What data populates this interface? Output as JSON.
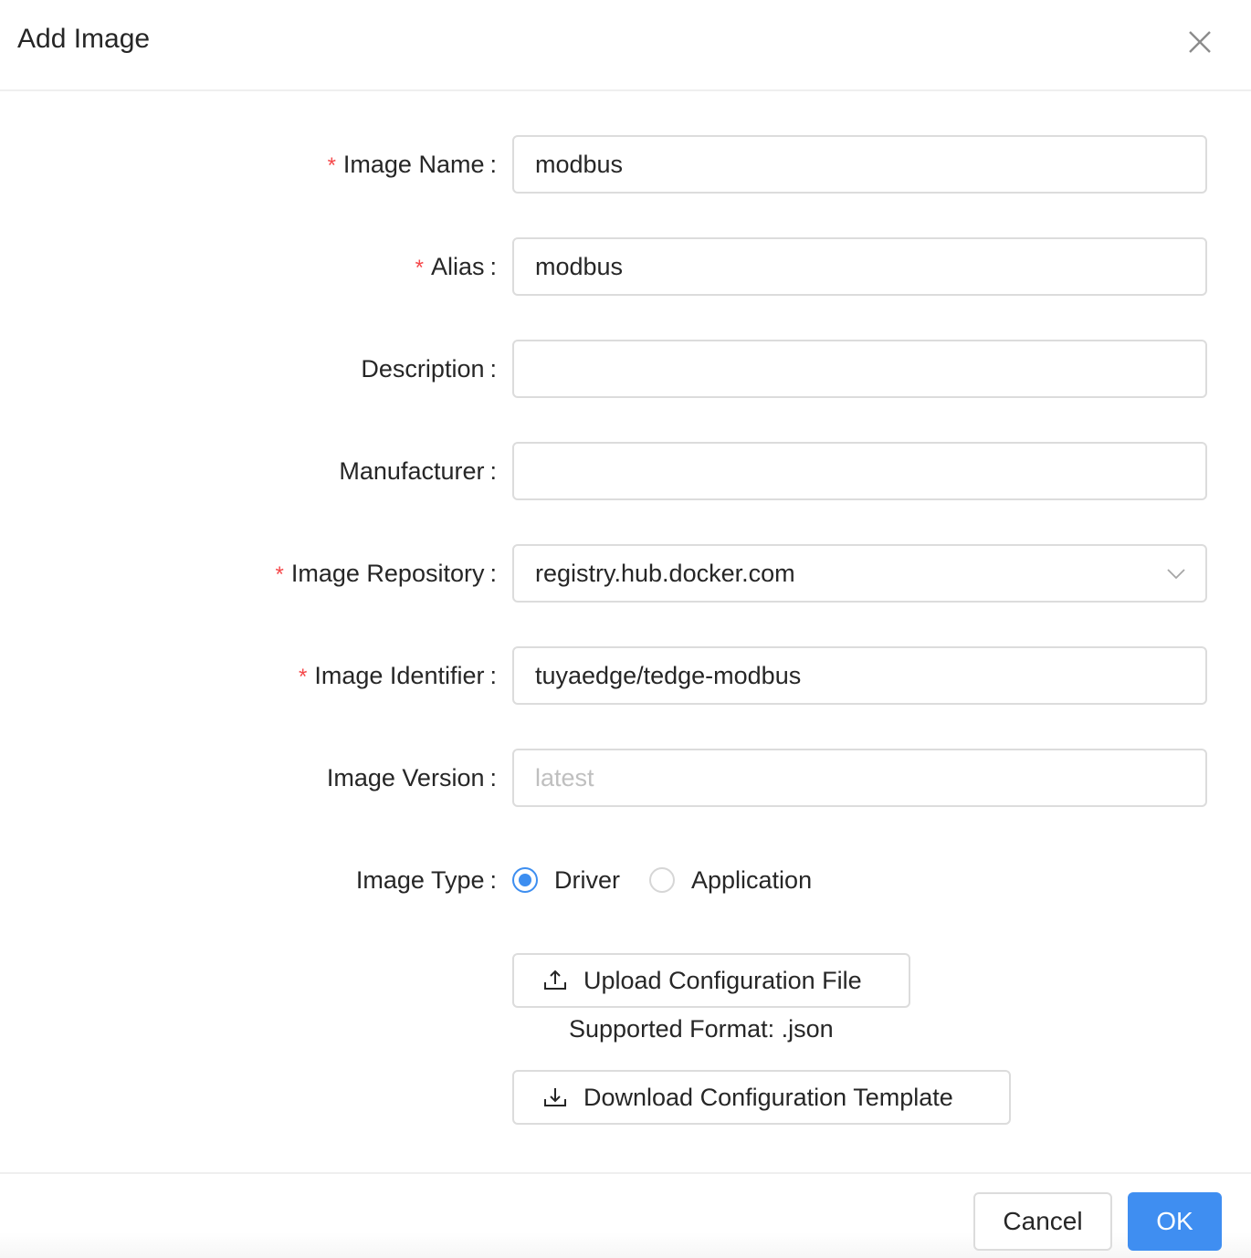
{
  "dialog": {
    "title": "Add Image",
    "close_icon": "close-icon"
  },
  "form": {
    "required_mark": "*",
    "colon": ":",
    "fields": {
      "image_name": {
        "label": "Image Name",
        "required": true,
        "value": "modbus",
        "placeholder": ""
      },
      "alias": {
        "label": "Alias",
        "required": true,
        "value": "modbus",
        "placeholder": ""
      },
      "description": {
        "label": "Description",
        "required": false,
        "value": "",
        "placeholder": ""
      },
      "manufacturer": {
        "label": "Manufacturer",
        "required": false,
        "value": "",
        "placeholder": ""
      },
      "image_repository": {
        "label": "Image Repository",
        "required": true,
        "value": "registry.hub.docker.com",
        "icon": "chevron-down-icon"
      },
      "image_identifier": {
        "label": "Image Identifier",
        "required": true,
        "value": "tuyaedge/tedge-modbus",
        "placeholder": ""
      },
      "image_version": {
        "label": "Image Version",
        "required": false,
        "value": "",
        "placeholder": "latest"
      },
      "image_type": {
        "label": "Image Type",
        "options": [
          {
            "label": "Driver",
            "selected": true
          },
          {
            "label": "Application",
            "selected": false
          }
        ]
      }
    },
    "upload_button": {
      "label": "Upload Configuration File",
      "icon": "upload-icon"
    },
    "supported_format": "Supported Format: .json",
    "download_button": {
      "label": "Download Configuration Template",
      "icon": "download-icon"
    }
  },
  "footer": {
    "cancel_label": "Cancel",
    "ok_label": "OK"
  },
  "colors": {
    "primary": "#3f8ef1",
    "required": "#f5484a",
    "border": "#dcdcdc",
    "placeholder": "#bfbfbf"
  }
}
